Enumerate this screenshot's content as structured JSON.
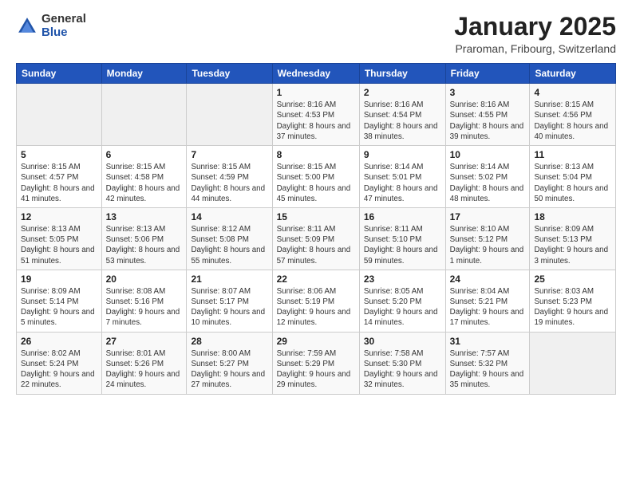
{
  "logo": {
    "general": "General",
    "blue": "Blue"
  },
  "header": {
    "month": "January 2025",
    "location": "Praroman, Fribourg, Switzerland"
  },
  "weekdays": [
    "Sunday",
    "Monday",
    "Tuesday",
    "Wednesday",
    "Thursday",
    "Friday",
    "Saturday"
  ],
  "weeks": [
    [
      {
        "day": "",
        "info": ""
      },
      {
        "day": "",
        "info": ""
      },
      {
        "day": "",
        "info": ""
      },
      {
        "day": "1",
        "info": "Sunrise: 8:16 AM\nSunset: 4:53 PM\nDaylight: 8 hours and 37 minutes."
      },
      {
        "day": "2",
        "info": "Sunrise: 8:16 AM\nSunset: 4:54 PM\nDaylight: 8 hours and 38 minutes."
      },
      {
        "day": "3",
        "info": "Sunrise: 8:16 AM\nSunset: 4:55 PM\nDaylight: 8 hours and 39 minutes."
      },
      {
        "day": "4",
        "info": "Sunrise: 8:15 AM\nSunset: 4:56 PM\nDaylight: 8 hours and 40 minutes."
      }
    ],
    [
      {
        "day": "5",
        "info": "Sunrise: 8:15 AM\nSunset: 4:57 PM\nDaylight: 8 hours and 41 minutes."
      },
      {
        "day": "6",
        "info": "Sunrise: 8:15 AM\nSunset: 4:58 PM\nDaylight: 8 hours and 42 minutes."
      },
      {
        "day": "7",
        "info": "Sunrise: 8:15 AM\nSunset: 4:59 PM\nDaylight: 8 hours and 44 minutes."
      },
      {
        "day": "8",
        "info": "Sunrise: 8:15 AM\nSunset: 5:00 PM\nDaylight: 8 hours and 45 minutes."
      },
      {
        "day": "9",
        "info": "Sunrise: 8:14 AM\nSunset: 5:01 PM\nDaylight: 8 hours and 47 minutes."
      },
      {
        "day": "10",
        "info": "Sunrise: 8:14 AM\nSunset: 5:02 PM\nDaylight: 8 hours and 48 minutes."
      },
      {
        "day": "11",
        "info": "Sunrise: 8:13 AM\nSunset: 5:04 PM\nDaylight: 8 hours and 50 minutes."
      }
    ],
    [
      {
        "day": "12",
        "info": "Sunrise: 8:13 AM\nSunset: 5:05 PM\nDaylight: 8 hours and 51 minutes."
      },
      {
        "day": "13",
        "info": "Sunrise: 8:13 AM\nSunset: 5:06 PM\nDaylight: 8 hours and 53 minutes."
      },
      {
        "day": "14",
        "info": "Sunrise: 8:12 AM\nSunset: 5:08 PM\nDaylight: 8 hours and 55 minutes."
      },
      {
        "day": "15",
        "info": "Sunrise: 8:11 AM\nSunset: 5:09 PM\nDaylight: 8 hours and 57 minutes."
      },
      {
        "day": "16",
        "info": "Sunrise: 8:11 AM\nSunset: 5:10 PM\nDaylight: 8 hours and 59 minutes."
      },
      {
        "day": "17",
        "info": "Sunrise: 8:10 AM\nSunset: 5:12 PM\nDaylight: 9 hours and 1 minute."
      },
      {
        "day": "18",
        "info": "Sunrise: 8:09 AM\nSunset: 5:13 PM\nDaylight: 9 hours and 3 minutes."
      }
    ],
    [
      {
        "day": "19",
        "info": "Sunrise: 8:09 AM\nSunset: 5:14 PM\nDaylight: 9 hours and 5 minutes."
      },
      {
        "day": "20",
        "info": "Sunrise: 8:08 AM\nSunset: 5:16 PM\nDaylight: 9 hours and 7 minutes."
      },
      {
        "day": "21",
        "info": "Sunrise: 8:07 AM\nSunset: 5:17 PM\nDaylight: 9 hours and 10 minutes."
      },
      {
        "day": "22",
        "info": "Sunrise: 8:06 AM\nSunset: 5:19 PM\nDaylight: 9 hours and 12 minutes."
      },
      {
        "day": "23",
        "info": "Sunrise: 8:05 AM\nSunset: 5:20 PM\nDaylight: 9 hours and 14 minutes."
      },
      {
        "day": "24",
        "info": "Sunrise: 8:04 AM\nSunset: 5:21 PM\nDaylight: 9 hours and 17 minutes."
      },
      {
        "day": "25",
        "info": "Sunrise: 8:03 AM\nSunset: 5:23 PM\nDaylight: 9 hours and 19 minutes."
      }
    ],
    [
      {
        "day": "26",
        "info": "Sunrise: 8:02 AM\nSunset: 5:24 PM\nDaylight: 9 hours and 22 minutes."
      },
      {
        "day": "27",
        "info": "Sunrise: 8:01 AM\nSunset: 5:26 PM\nDaylight: 9 hours and 24 minutes."
      },
      {
        "day": "28",
        "info": "Sunrise: 8:00 AM\nSunset: 5:27 PM\nDaylight: 9 hours and 27 minutes."
      },
      {
        "day": "29",
        "info": "Sunrise: 7:59 AM\nSunset: 5:29 PM\nDaylight: 9 hours and 29 minutes."
      },
      {
        "day": "30",
        "info": "Sunrise: 7:58 AM\nSunset: 5:30 PM\nDaylight: 9 hours and 32 minutes."
      },
      {
        "day": "31",
        "info": "Sunrise: 7:57 AM\nSunset: 5:32 PM\nDaylight: 9 hours and 35 minutes."
      },
      {
        "day": "",
        "info": ""
      }
    ]
  ]
}
